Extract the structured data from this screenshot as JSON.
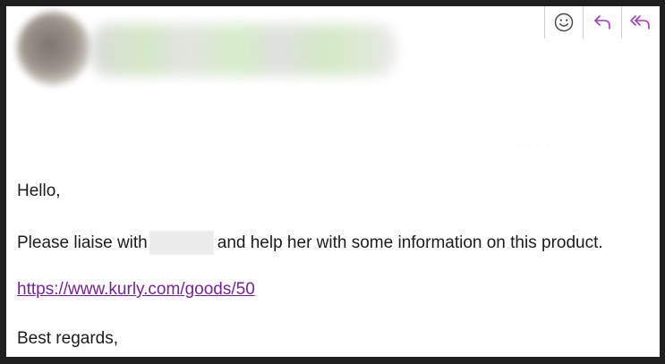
{
  "email": {
    "greeting": "Hello,",
    "line2_before": "Please liaise with",
    "line2_after": "and help her with some information on this product.",
    "link": "https://www.kurly.com/goods/50",
    "signoff": "Best regards,"
  },
  "actions": [
    {
      "icon": "emoji-smile-icon"
    },
    {
      "icon": "reply-icon"
    },
    {
      "icon": "reply-all-icon"
    }
  ],
  "colors": {
    "accent": "#a23fb8",
    "link": "#7a1fa2",
    "background": "#ffffff",
    "window_border": "#1f1f1f"
  }
}
